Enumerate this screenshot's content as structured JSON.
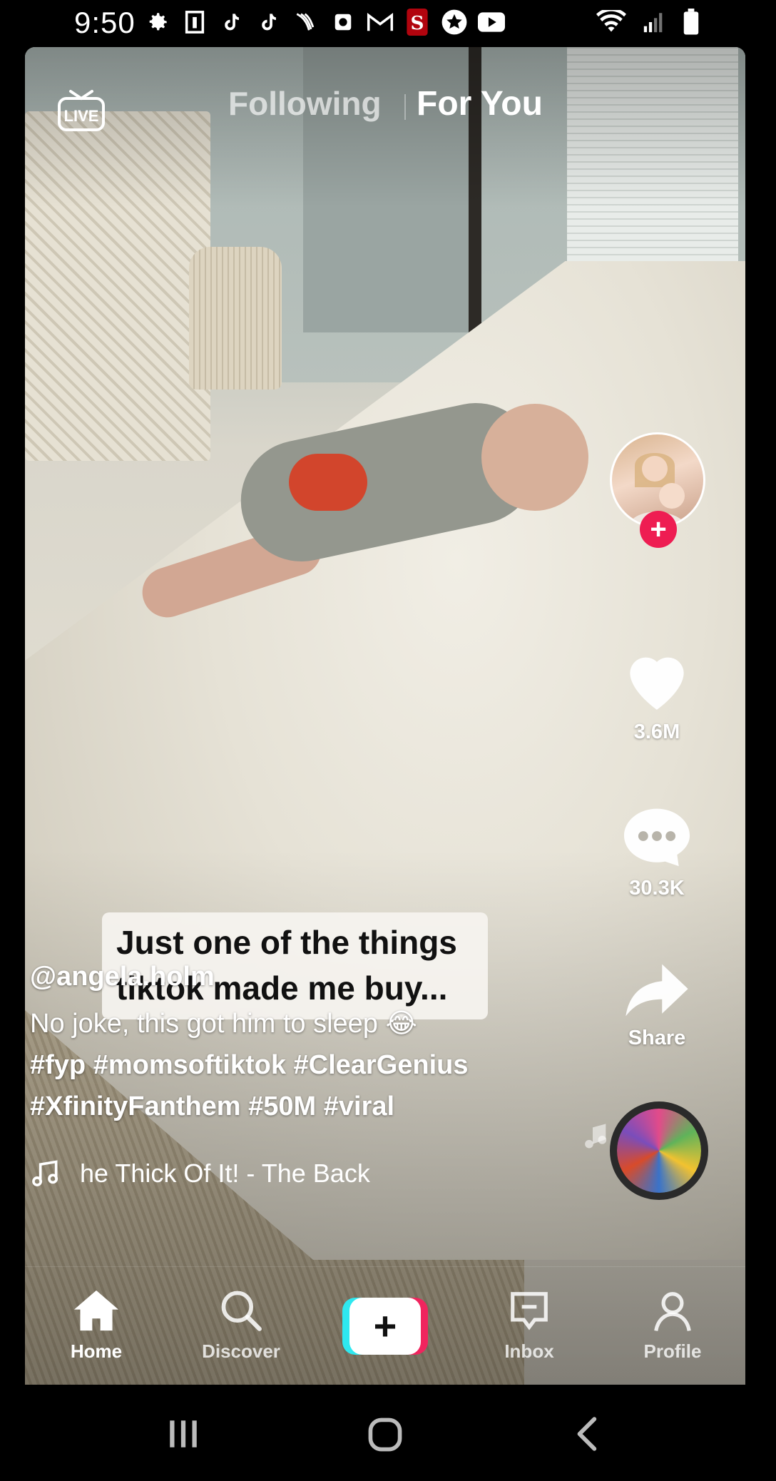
{
  "status_bar": {
    "time": "9:50",
    "left_icons": [
      "settings-icon",
      "image-icon",
      "tiktok-icon",
      "tiktok-icon",
      "sprint-icon",
      "camera-app-icon",
      "gmail-icon",
      "stanford-app-icon",
      "star-app-icon",
      "youtube-icon"
    ],
    "right_icons": [
      "wifi-icon",
      "signal-icon",
      "battery-icon"
    ]
  },
  "top_nav": {
    "live": "LIVE",
    "following": "Following",
    "for_you": "For You"
  },
  "video": {
    "sticker_text": "Just one of the things tiktok made me buy...",
    "username": "@angela.holm",
    "description": "No joke, this got him to sleep 😂",
    "hashtags_line1": "#fyp #momsoftiktok #ClearGenius",
    "hashtags_line2": "#XfinityFanthem #50M #viral",
    "sound": "he Thick Of It! - The Back"
  },
  "actions": {
    "likes": "3.6M",
    "comments": "30.3K",
    "share": "Share"
  },
  "bottom_nav": {
    "home": "Home",
    "discover": "Discover",
    "inbox": "Inbox",
    "profile": "Profile"
  },
  "colors": {
    "accent_red": "#ee1d52",
    "accent_cyan": "#2ee8f0"
  }
}
